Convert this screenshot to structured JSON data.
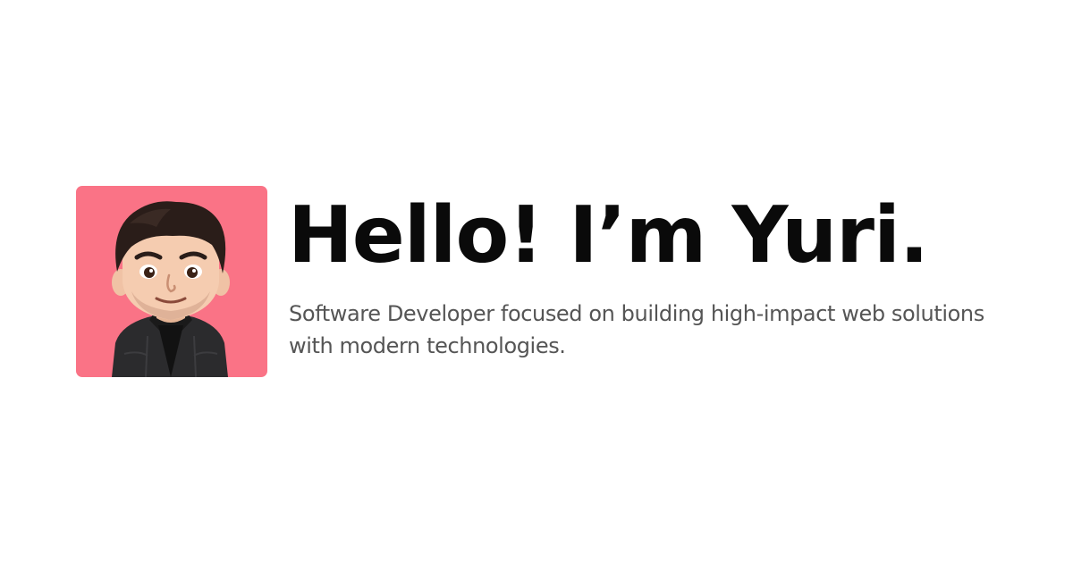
{
  "profile": {
    "headline": "Hello! I’m Yuri.",
    "subtitle": "Software Developer focused on building high-impact web solutions with modern technologies."
  },
  "colors": {
    "avatar_background": "#fa7386",
    "headline": "#0a0a0a",
    "subtitle": "#555555",
    "page_background": "#ffffff"
  },
  "icons": {
    "avatar": "cartoon-avatar-illustration"
  }
}
